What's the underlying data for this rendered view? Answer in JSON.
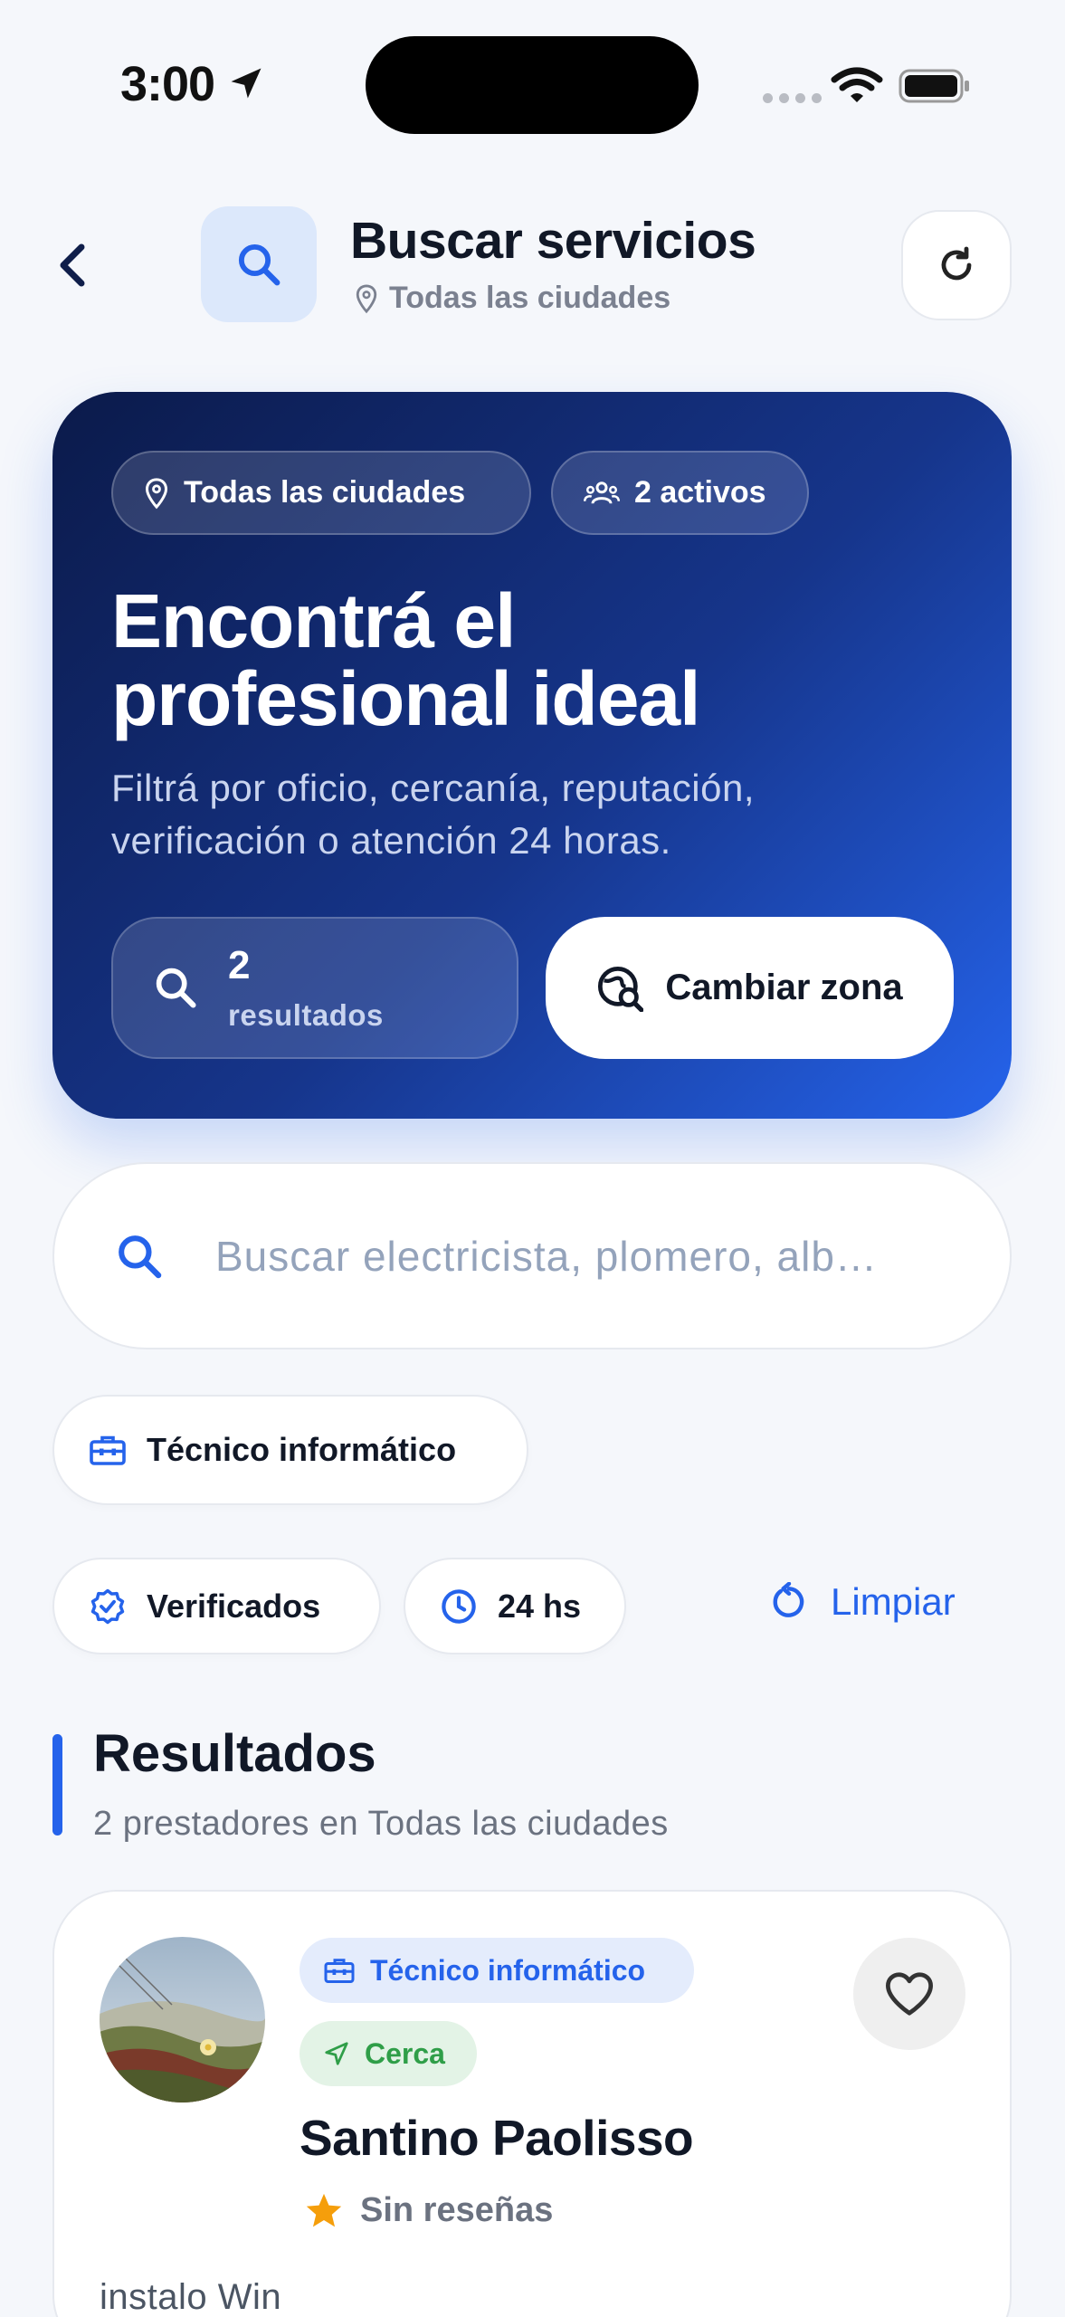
{
  "status_bar": {
    "time": "3:00"
  },
  "header": {
    "title": "Buscar servicios",
    "location": "Todas las ciudades"
  },
  "hero": {
    "city_chip": "Todas las ciudades",
    "active_chip": "2 activos",
    "title": "Encontrá el profesional ideal",
    "description": "Filtrá por oficio, cercanía, reputación, verificación o atención 24 horas.",
    "results_count": "2",
    "results_label": "resultados",
    "change_zone_label": "Cambiar zona"
  },
  "search": {
    "placeholder": "Buscar electricista, plomero, alb…"
  },
  "filters": {
    "category": "Técnico informático",
    "verified": "Verificados",
    "hours": "24 hs",
    "clear": "Limpiar"
  },
  "results": {
    "title": "Resultados",
    "subtitle": "2 prestadores en Todas las ciudades",
    "items": [
      {
        "category": "Técnico informático",
        "proximity": "Cerca",
        "name": "Santino Paolisso",
        "rating_text": "Sin reseñas",
        "description": "instalo Win"
      }
    ]
  },
  "colors": {
    "accent": "#2563eb",
    "hero_start": "#0b1a4a",
    "hero_end": "#2563eb",
    "near_green": "#2f9e48",
    "star": "#f59e0b"
  }
}
